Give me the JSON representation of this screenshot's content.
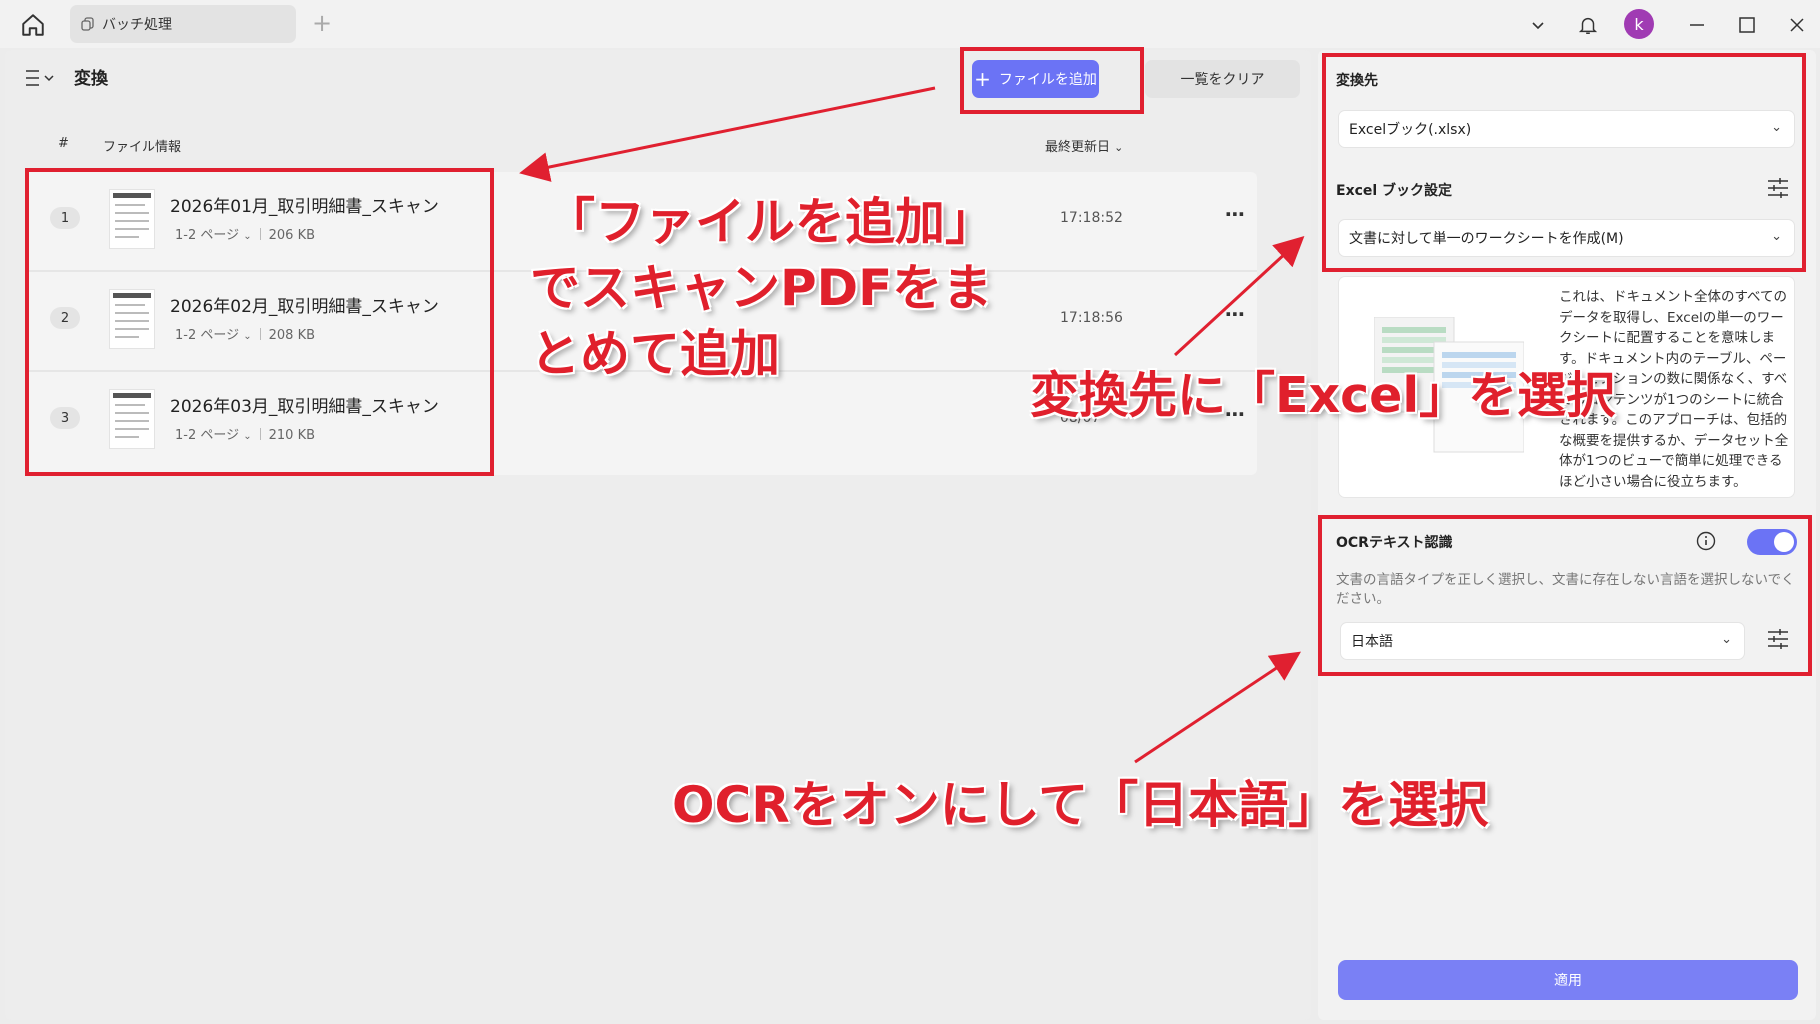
{
  "titlebar": {
    "tab_label": "バッチ処理",
    "avatar_letter": "k"
  },
  "panel": {
    "title": "変換",
    "add_button": "ファイルを追加",
    "clear_button": "一覧をクリア",
    "columns": {
      "num": "#",
      "info": "ファイル情報",
      "date": "最終更新日"
    }
  },
  "files": [
    {
      "num": "1",
      "name": "2026年01月_取引明細書_スキャン",
      "pages": "1-2 ページ",
      "size": "206 KB",
      "time": "17:18:52"
    },
    {
      "num": "2",
      "name": "2026年02月_取引明細書_スキャン",
      "pages": "1-2 ページ",
      "size": "208 KB",
      "time": "17:18:56"
    },
    {
      "num": "3",
      "name": "2026年03月_取引明細書_スキャン",
      "pages": "1-2 ページ",
      "size": "210 KB",
      "time": "08/07"
    }
  ],
  "settings": {
    "target_label": "変換先",
    "target_value": "Excelブック(.xlsx)",
    "book_label": "Excel ブック設定",
    "book_value": "文書に対して単一のワークシートを作成(M)",
    "description": "これは、ドキュメント全体のすべてのデータを取得し、Excelの単一のワークシートに配置することを意味します。ドキュメント内のテーブル、ページ、セクションの数に関係なく、すべてのコンテンツが1つのシートに統合されます。このアプローチは、包括的な概要を提供するか、データセット全体が1つのビューで簡単に処理できるほど小さい場合に役立ちます。",
    "ocr_label": "OCRテキスト認識",
    "ocr_note": "文書の言語タイプを正しく選択し、文書に存在しない言語を選択しないでください。",
    "language": "日本語",
    "apply": "適用"
  },
  "annotations": {
    "add_note_line1": "「ファイルを追加」",
    "add_note_line2": "でスキャンPDFをま",
    "add_note_line3": "とめて追加",
    "excel_note": "変換先に「Excel」を選択",
    "ocr_note": "OCRをオンにして「日本語」を選択"
  },
  "colors": {
    "accent": "#6b73f5",
    "annotation_red": "#e02030"
  }
}
